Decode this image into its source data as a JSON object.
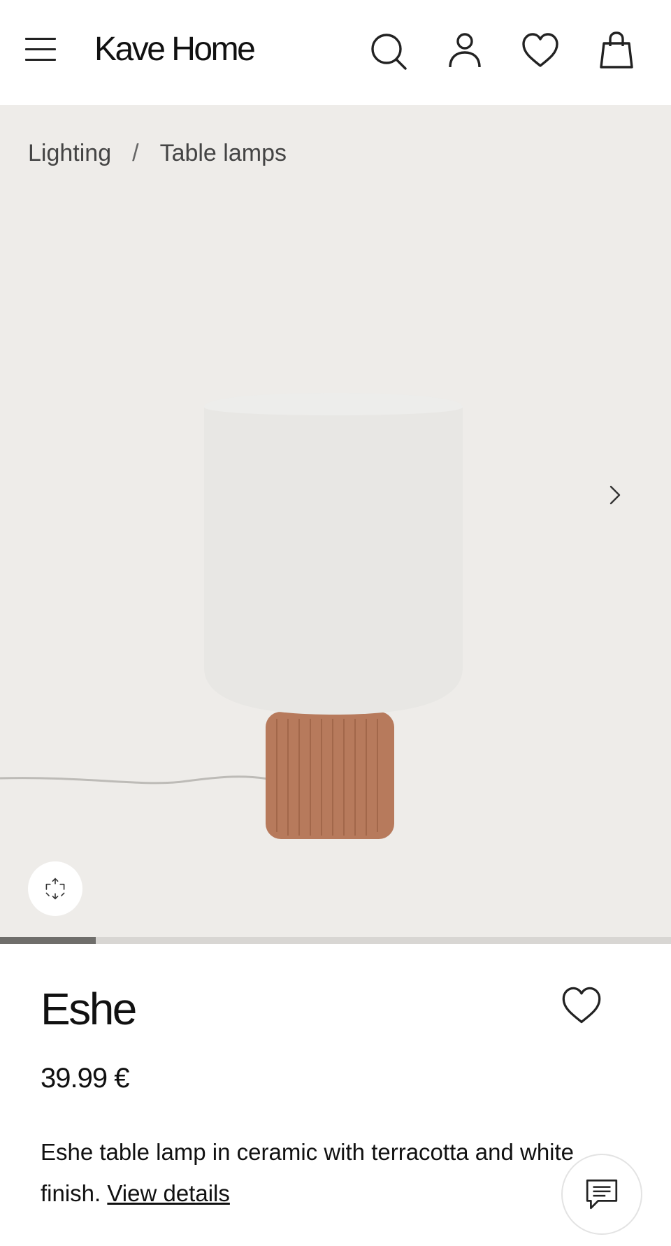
{
  "header": {
    "logo": "Kave Home",
    "icons": [
      "menu-icon",
      "search-icon",
      "account-icon",
      "heart-icon",
      "bag-icon"
    ]
  },
  "breadcrumb": {
    "items": [
      "Lighting",
      "Table lamps"
    ],
    "separator": "/"
  },
  "gallery": {
    "progress": 0.143,
    "background": "#eeece9",
    "lamp_shade_color": "#e8e7e4",
    "lamp_base_color": "#b77a5c"
  },
  "product": {
    "name": "Eshe",
    "price": "39.99 €",
    "description": "Eshe table lamp in ceramic with terracotta and white finish.",
    "details_link": "View details"
  }
}
